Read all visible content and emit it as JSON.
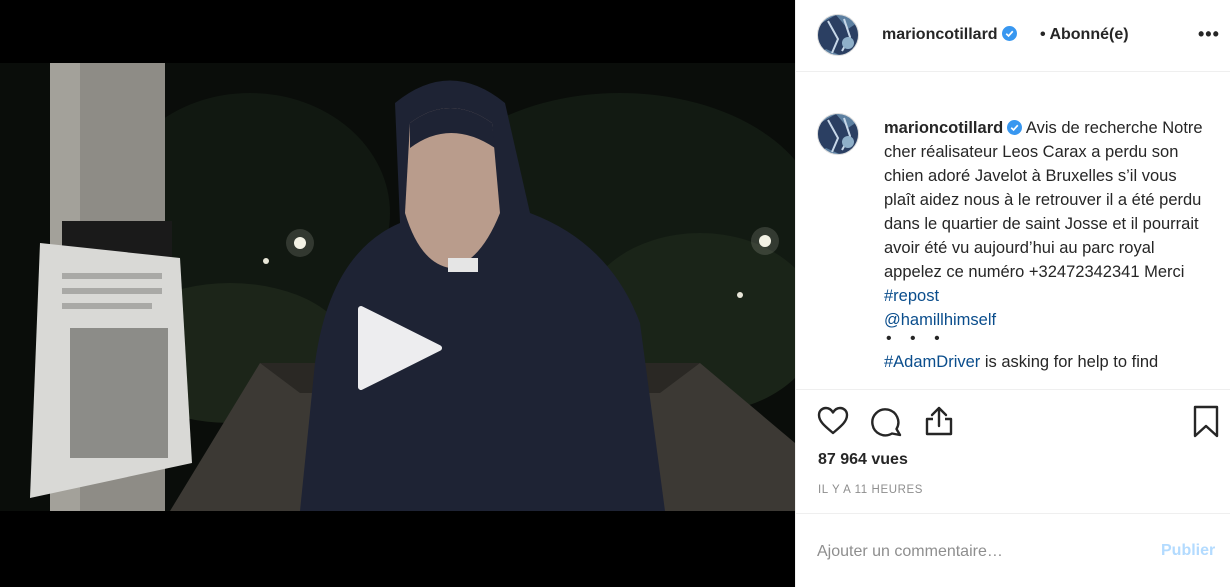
{
  "post": {
    "username": "marioncotillard",
    "follow_status": "• Abonné(e)",
    "more_label": "•••",
    "caption_text": "Avis de recherche Notre cher réalisateur Leos Carax a perdu son chien adoré Javelot à Bruxelles s’il vous plaît aidez nous à le retrouver il a été perdu dans le quartier de saint Josse et il pourrait avoir été vu aujourd’hui au parc royal appelez ce numéro +32472342341 Merci ",
    "caption_hashtag": "#repost",
    "caption_mention": "@hamillhimself",
    "caption_ellipsis": "• • •",
    "caption_hashtag2": "#AdamDriver",
    "caption_continuation": " is asking for help to find",
    "views": "87 964 vues",
    "timestamp": "IL Y A 11 HEURES"
  },
  "comment_box": {
    "placeholder": "Ajouter un commentaire…",
    "publish_label": "Publier"
  },
  "icons": {
    "like": "heart-icon",
    "comment": "comment-bubble-icon",
    "share": "share-icon",
    "save": "bookmark-icon",
    "verified": "verified-badge-icon",
    "play": "play-icon"
  },
  "colors": {
    "hashtag": "#0a4d8c",
    "verified": "#3897f0",
    "publish_disabled": "#b3dbff",
    "muted": "#8e8e8e"
  }
}
